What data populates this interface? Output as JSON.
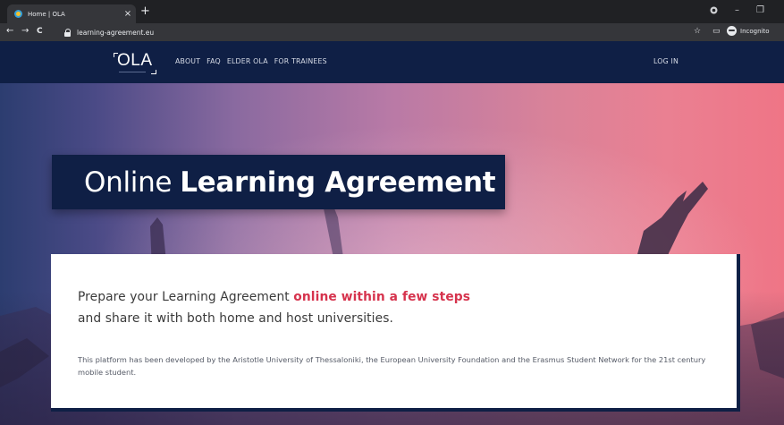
{
  "browser": {
    "tab_title": "Home | OLA",
    "tab_close": "×",
    "new_tab": "+",
    "url": "learning-agreement.eu",
    "incognito_label": "Incognito",
    "back": "←",
    "forward": "→",
    "reload": "C",
    "minimize": "–",
    "restore": "❐",
    "bookmark": "☆",
    "cast": "▭"
  },
  "header": {
    "logo": "OLA",
    "menu": [
      "ABOUT",
      "FAQ",
      "ELDER OLA",
      "FOR TRAINEES"
    ],
    "login": "LOG IN"
  },
  "hero": {
    "title_light": "Online",
    "title_bold": "Learning Agreement"
  },
  "card": {
    "lead_prefix": "Prepare your Learning Agreement ",
    "lead_highlight": "online within a few steps",
    "lead_line2": "and share it with both home and host universities.",
    "description": "This platform has been developed by the Aristotle University of Thessaloniki, the European University Foundation and the Erasmus Student Network for the 21st century mobile student."
  },
  "colors": {
    "navy": "#0f1f45",
    "accent": "#d6334d"
  }
}
